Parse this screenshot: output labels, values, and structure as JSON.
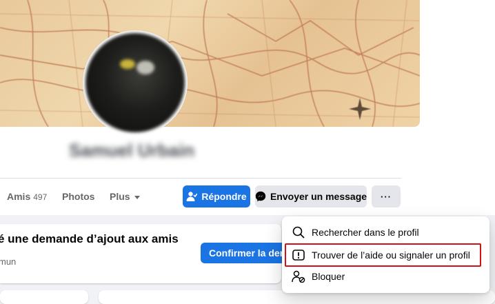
{
  "profile": {
    "name": "Samuel Urbain"
  },
  "tabs": [
    {
      "label": "Amis",
      "count": "497"
    },
    {
      "label": "Photos"
    },
    {
      "label": "Plus"
    }
  ],
  "actions": {
    "respond_label": "Répondre",
    "message_label": "Envoyer un message",
    "more_label": "···"
  },
  "friend_request": {
    "title": "é une demande d’ajout aux amis",
    "subtitle": "mun",
    "confirm_label": "Confirmer la dema"
  },
  "menu": {
    "items": [
      {
        "label": "Rechercher dans le profil",
        "icon": "search-icon"
      },
      {
        "label": "Trouver de l’aide ou signaler un profil",
        "icon": "report-icon"
      },
      {
        "label": "Bloquer",
        "icon": "block-user-icon"
      }
    ]
  },
  "colors": {
    "primary": "#1b74e4",
    "secondary_button": "#e4e6eb",
    "highlight_border": "#d0111a",
    "page_background": "#f0f2f5"
  }
}
